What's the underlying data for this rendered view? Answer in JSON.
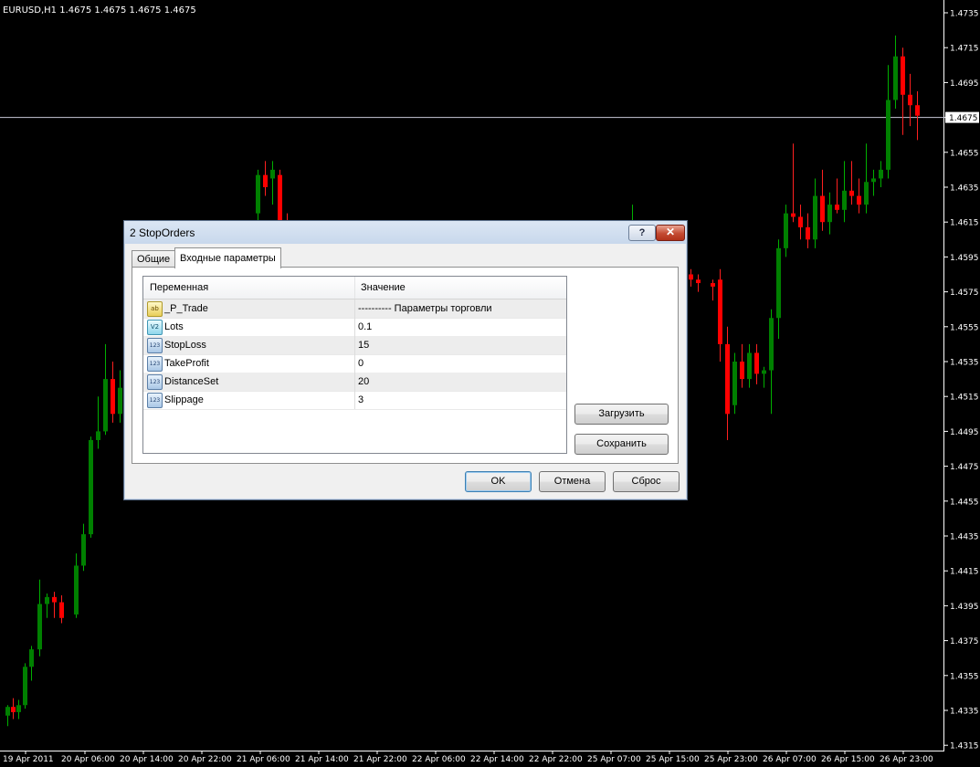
{
  "chart": {
    "title": "EURUSD,H1  1.4675 1.4675 1.4675 1.4675",
    "current_price": "1.4675",
    "price_labels": [
      "1.4735",
      "1.4715",
      "1.4695",
      "1.4675",
      "1.4655",
      "1.4635",
      "1.4615",
      "1.4595",
      "1.4575",
      "1.4555",
      "1.4535",
      "1.4515",
      "1.4495",
      "1.4475",
      "1.4455",
      "1.4435",
      "1.4415",
      "1.4395",
      "1.4375",
      "1.4355",
      "1.4335",
      "1.4315"
    ],
    "time_labels": [
      "19 Apr 2011",
      "20 Apr 06:00",
      "20 Apr 14:00",
      "20 Apr 22:00",
      "21 Apr 06:00",
      "21 Apr 14:00",
      "21 Apr 22:00",
      "22 Apr 06:00",
      "22 Apr 14:00",
      "22 Apr 22:00",
      "25 Apr 07:00",
      "25 Apr 15:00",
      "25 Apr 23:00",
      "26 Apr 07:00",
      "26 Apr 15:00",
      "26 Apr 23:00"
    ],
    "colors": {
      "bull": "#008000",
      "bear": "#ff0000",
      "wick_bull": "#00b000",
      "wick_bear": "#ff2020",
      "axis": "#ffffff",
      "price_line": "#c8c8d8"
    }
  },
  "dialog": {
    "title": "2 StopOrders",
    "help_label": "?",
    "close_label": "✕",
    "tabs": {
      "general": "Общие",
      "inputs": "Входные параметры"
    },
    "columns": {
      "variable": "Переменная",
      "value": "Значение"
    },
    "rows": [
      {
        "icon": "ab",
        "name": "_P_Trade",
        "value": "---------- Параметры торговли"
      },
      {
        "icon": "V2",
        "name": "Lots",
        "value": "0.1"
      },
      {
        "icon": "123",
        "name": "StopLoss",
        "value": "15"
      },
      {
        "icon": "123",
        "name": "TakeProfit",
        "value": "0"
      },
      {
        "icon": "123",
        "name": "DistanceSet",
        "value": "20"
      },
      {
        "icon": "123",
        "name": "Slippage",
        "value": "3"
      }
    ],
    "buttons": {
      "load": "Загрузить",
      "save": "Сохранить",
      "ok": "OK",
      "cancel": "Отмена",
      "reset": "Сброс"
    }
  }
}
